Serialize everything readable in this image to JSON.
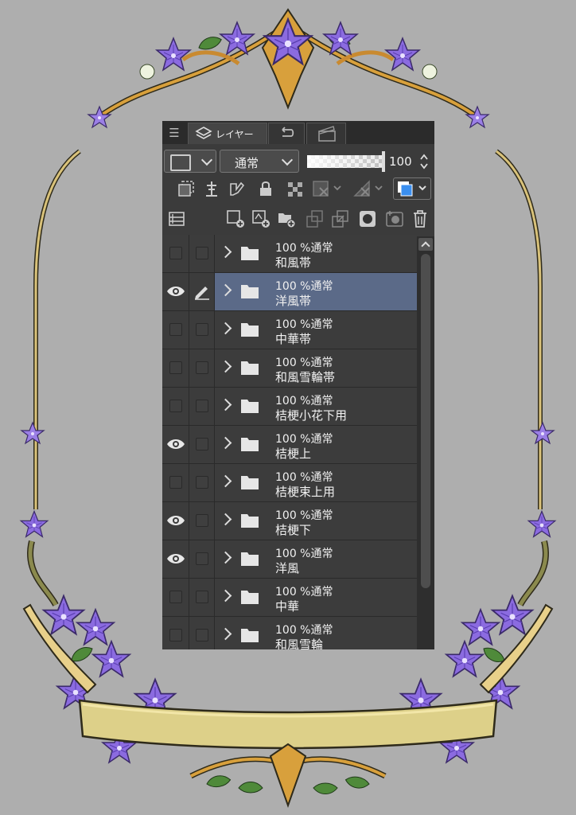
{
  "panel": {
    "tabs": [
      {
        "label": "レイヤー",
        "icon": "layers-icon"
      },
      {
        "label": "",
        "icon": "history-undo-icon"
      },
      {
        "label": "",
        "icon": "animation-clapper-icon"
      }
    ],
    "blend_mode": "通常",
    "opacity": 100,
    "opacity_text": "100",
    "colors": {
      "panel_bg": "#3b3b3b",
      "selected_row": "#5b6a88",
      "layer_color": "#3a8ff0"
    },
    "layers": [
      {
        "opacity_mode": "100 %通常",
        "name": "和風帯",
        "visible": false,
        "editing": false,
        "selected": false
      },
      {
        "opacity_mode": "100 %通常",
        "name": "洋風帯",
        "visible": true,
        "editing": true,
        "selected": true
      },
      {
        "opacity_mode": "100 %通常",
        "name": "中華帯",
        "visible": false,
        "editing": false,
        "selected": false
      },
      {
        "opacity_mode": "100 %通常",
        "name": "和風雪輪帯",
        "visible": false,
        "editing": false,
        "selected": false
      },
      {
        "opacity_mode": "100 %通常",
        "name": "桔梗小花下用",
        "visible": false,
        "editing": false,
        "selected": false
      },
      {
        "opacity_mode": "100 %通常",
        "name": "桔梗上",
        "visible": true,
        "editing": false,
        "selected": false
      },
      {
        "opacity_mode": "100 %通常",
        "name": "桔梗束上用",
        "visible": false,
        "editing": false,
        "selected": false
      },
      {
        "opacity_mode": "100 %通常",
        "name": "桔梗下",
        "visible": true,
        "editing": false,
        "selected": false
      },
      {
        "opacity_mode": "100 %通常",
        "name": "洋風",
        "visible": true,
        "editing": false,
        "selected": false
      },
      {
        "opacity_mode": "100 %通常",
        "name": "中華",
        "visible": false,
        "editing": false,
        "selected": false
      },
      {
        "opacity_mode": "100 %通常",
        "name": "和風雪輪",
        "visible": false,
        "editing": false,
        "selected": false
      }
    ]
  }
}
